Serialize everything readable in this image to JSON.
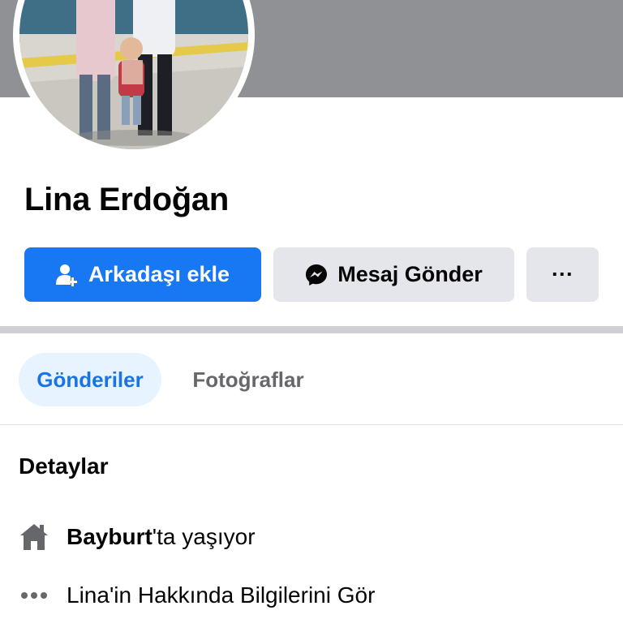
{
  "profile": {
    "name": "Lina Erdoğan"
  },
  "actions": {
    "add_friend_label": "Arkadaşı ekle",
    "message_label": "Mesaj Gönder",
    "more_label": "···"
  },
  "tabs": [
    {
      "label": "Gönderiler",
      "selected": true
    },
    {
      "label": "Fotoğraflar",
      "selected": false
    }
  ],
  "details": {
    "title": "Detaylar",
    "location_city": "Bayburt",
    "location_suffix": "'ta yaşıyor",
    "about_link": "Lina'in Hakkında Bilgilerini Gör"
  },
  "colors": {
    "primary": "#1877f2",
    "secondary_button": "#e4e6eb",
    "selected_tab_bg": "#e7f3ff",
    "selected_tab_text": "#1b74e4",
    "muted_text": "#65676b",
    "cover": "#8f9195"
  },
  "icons": {
    "add_friend": "add-friend-icon",
    "message": "messenger-icon",
    "more": "more-dots-icon",
    "home": "home-icon",
    "about": "ellipsis-icon"
  }
}
